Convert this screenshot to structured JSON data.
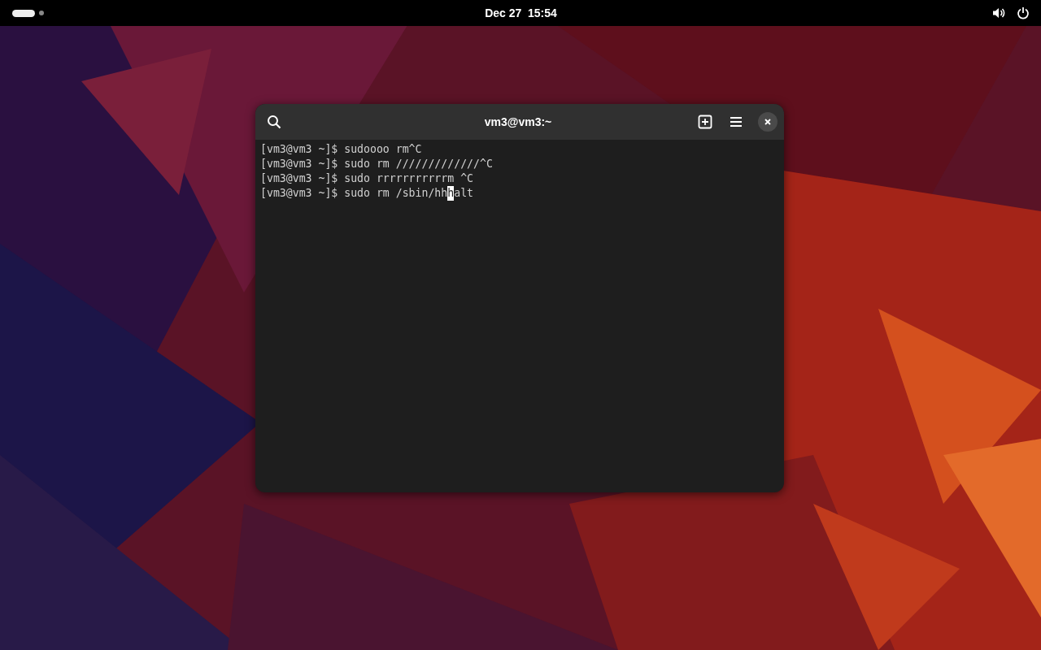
{
  "top_bar": {
    "clock": "Dec 27  15:54"
  },
  "window": {
    "title": "vm3@vm3:~",
    "terminal": {
      "lines": [
        {
          "text": "[vm3@vm3 ~]$ sudoooo rm^C"
        },
        {
          "text": "[vm3@vm3 ~]$ sudo rm /////////////^C"
        },
        {
          "text": "[vm3@vm3 ~]$ sudo rrrrrrrrrrrm ^C"
        },
        {
          "text": "[vm3@vm3 ~]$ sudo rm /sbin/hh",
          "cursor": "h",
          "after_cursor": "alt"
        }
      ]
    }
  }
}
